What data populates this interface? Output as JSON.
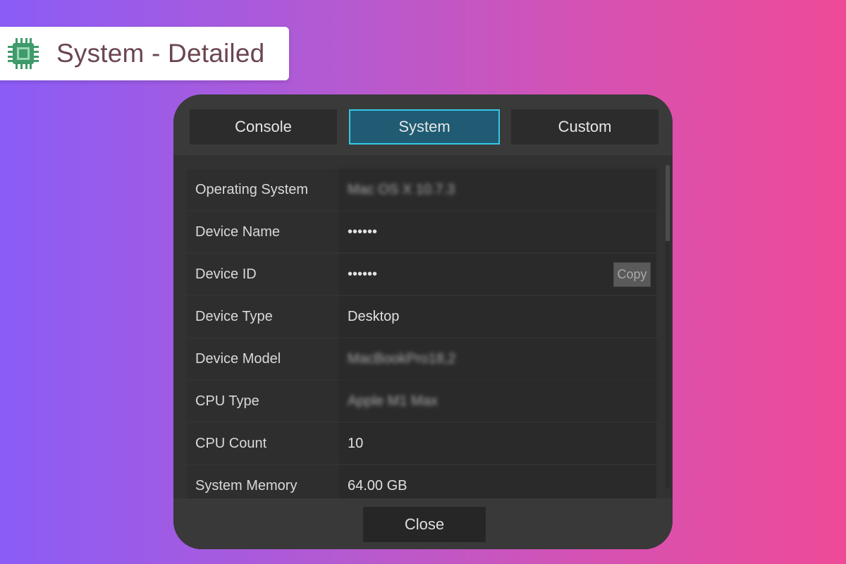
{
  "header": {
    "title": "System - Detailed",
    "icon": "cpu-chip-icon",
    "icon_color": "#3f9b6b"
  },
  "tabs": [
    {
      "label": "Console",
      "active": false
    },
    {
      "label": "System",
      "active": true
    },
    {
      "label": "Custom",
      "active": false
    }
  ],
  "system_info": {
    "rows": [
      {
        "key": "Operating System",
        "value": "Mac OS X 10.7.3",
        "blurred": true
      },
      {
        "key": "Device Name",
        "value": "••••••",
        "blurred": false
      },
      {
        "key": "Device ID",
        "value": "••••••",
        "blurred": false
      },
      {
        "key": "Device Type",
        "value": "Desktop",
        "blurred": false
      },
      {
        "key": "Device Model",
        "value": "MacBookPro18,2",
        "blurred": true
      },
      {
        "key": "CPU Type",
        "value": "Apple M1 Max",
        "blurred": true
      },
      {
        "key": "CPU Count",
        "value": "10",
        "blurred": false
      },
      {
        "key": "System Memory",
        "value": "64.00 GB",
        "blurred": false
      }
    ],
    "copy_label": "Copy"
  },
  "footer": {
    "close_label": "Close"
  },
  "colors": {
    "active_tab": "#1f5c73",
    "active_tab_border": "#35c8e6",
    "panel_bg": "#2a2a2a"
  }
}
